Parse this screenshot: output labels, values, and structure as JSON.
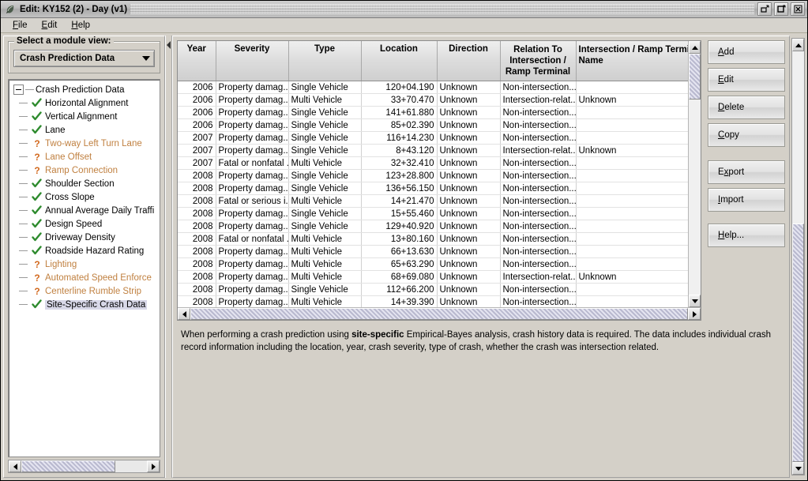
{
  "window": {
    "title": "Edit: KY152 (2) - Day (v1)",
    "icon": "app-leaf-icon",
    "controls": [
      {
        "name": "restore-button",
        "icon": "restore-icon"
      },
      {
        "name": "maximize-button",
        "icon": "maximize-icon"
      },
      {
        "name": "close-button",
        "icon": "close-icon"
      }
    ]
  },
  "menubar": {
    "items": [
      {
        "label": "File",
        "mnemonic": "F"
      },
      {
        "label": "Edit",
        "mnemonic": "E"
      },
      {
        "label": "Help",
        "mnemonic": "H"
      }
    ]
  },
  "sidebar": {
    "group_legend": "Select a module view:",
    "combo": {
      "selected": "Crash Prediction Data",
      "icon": "chevron-down-icon"
    },
    "tree": {
      "root": {
        "label": "Crash Prediction Data",
        "expanded": true
      },
      "items": [
        {
          "label": "Horizontal Alignment",
          "status": "complete",
          "icon": "check-icon"
        },
        {
          "label": "Vertical Alignment",
          "status": "complete",
          "icon": "check-icon"
        },
        {
          "label": "Lane",
          "status": "complete",
          "icon": "check-icon"
        },
        {
          "label": "Two-way Left Turn Lane",
          "status": "warning",
          "icon": "question-icon"
        },
        {
          "label": "Lane Offset",
          "status": "warning",
          "icon": "question-icon"
        },
        {
          "label": "Ramp Connection",
          "status": "warning",
          "icon": "question-icon"
        },
        {
          "label": "Shoulder Section",
          "status": "complete",
          "icon": "check-icon"
        },
        {
          "label": "Cross Slope",
          "status": "complete",
          "icon": "check-icon"
        },
        {
          "label": "Annual Average Daily Traffi",
          "status": "complete",
          "icon": "check-icon"
        },
        {
          "label": "Design Speed",
          "status": "complete",
          "icon": "check-icon"
        },
        {
          "label": "Driveway Density",
          "status": "complete",
          "icon": "check-icon"
        },
        {
          "label": "Roadside Hazard Rating",
          "status": "complete",
          "icon": "check-icon"
        },
        {
          "label": "Lighting",
          "status": "warning",
          "icon": "question-icon"
        },
        {
          "label": "Automated Speed Enforce",
          "status": "warning",
          "icon": "question-icon"
        },
        {
          "label": "Centerline Rumble Strip",
          "status": "warning",
          "icon": "question-icon"
        },
        {
          "label": "Site-Specific Crash Data",
          "status": "complete",
          "icon": "check-icon",
          "selected": true
        }
      ]
    },
    "scrollbar": {
      "left_icon": "scroll-left-icon",
      "right_icon": "scroll-right-icon"
    }
  },
  "splitter": {
    "icon": "collapse-left-icon"
  },
  "table": {
    "columns": [
      "Year",
      "Severity",
      "Type",
      "Location",
      "Direction",
      "Relation To Intersection / Ramp Terminal",
      "Intersection / Ramp Terminal Name"
    ],
    "rows": [
      {
        "year": "2006",
        "severity": "Property damag...",
        "type": "Single Vehicle",
        "location": "120+04.190",
        "direction": "Unknown",
        "relation": "Non-intersection...",
        "name": ""
      },
      {
        "year": "2006",
        "severity": "Property damag...",
        "type": "Multi Vehicle",
        "location": "33+70.470",
        "direction": "Unknown",
        "relation": "Intersection-relat...",
        "name": "Unknown"
      },
      {
        "year": "2006",
        "severity": "Property damag...",
        "type": "Single Vehicle",
        "location": "141+61.880",
        "direction": "Unknown",
        "relation": "Non-intersection...",
        "name": ""
      },
      {
        "year": "2006",
        "severity": "Property damag...",
        "type": "Single Vehicle",
        "location": "85+02.390",
        "direction": "Unknown",
        "relation": "Non-intersection...",
        "name": ""
      },
      {
        "year": "2007",
        "severity": "Property damag...",
        "type": "Single Vehicle",
        "location": "116+14.230",
        "direction": "Unknown",
        "relation": "Non-intersection...",
        "name": ""
      },
      {
        "year": "2007",
        "severity": "Property damag...",
        "type": "Single Vehicle",
        "location": "8+43.120",
        "direction": "Unknown",
        "relation": "Intersection-relat...",
        "name": "Unknown"
      },
      {
        "year": "2007",
        "severity": "Fatal or nonfatal ...",
        "type": "Multi Vehicle",
        "location": "32+32.410",
        "direction": "Unknown",
        "relation": "Non-intersection...",
        "name": ""
      },
      {
        "year": "2008",
        "severity": "Property damag...",
        "type": "Single Vehicle",
        "location": "123+28.800",
        "direction": "Unknown",
        "relation": "Non-intersection...",
        "name": ""
      },
      {
        "year": "2008",
        "severity": "Property damag...",
        "type": "Single Vehicle",
        "location": "136+56.150",
        "direction": "Unknown",
        "relation": "Non-intersection...",
        "name": ""
      },
      {
        "year": "2008",
        "severity": "Fatal or serious i...",
        "type": "Multi Vehicle",
        "location": "14+21.470",
        "direction": "Unknown",
        "relation": "Non-intersection...",
        "name": ""
      },
      {
        "year": "2008",
        "severity": "Property damag...",
        "type": "Single Vehicle",
        "location": "15+55.460",
        "direction": "Unknown",
        "relation": "Non-intersection...",
        "name": ""
      },
      {
        "year": "2008",
        "severity": "Property damag...",
        "type": "Single Vehicle",
        "location": "129+40.920",
        "direction": "Unknown",
        "relation": "Non-intersection...",
        "name": ""
      },
      {
        "year": "2008",
        "severity": "Fatal or nonfatal ...",
        "type": "Multi Vehicle",
        "location": "13+80.160",
        "direction": "Unknown",
        "relation": "Non-intersection...",
        "name": ""
      },
      {
        "year": "2008",
        "severity": "Property damag...",
        "type": "Multi Vehicle",
        "location": "66+13.630",
        "direction": "Unknown",
        "relation": "Non-intersection...",
        "name": ""
      },
      {
        "year": "2008",
        "severity": "Property damag...",
        "type": "Multi Vehicle",
        "location": "65+63.290",
        "direction": "Unknown",
        "relation": "Non-intersection...",
        "name": ""
      },
      {
        "year": "2008",
        "severity": "Property damag...",
        "type": "Multi Vehicle",
        "location": "68+69.080",
        "direction": "Unknown",
        "relation": "Intersection-relat...",
        "name": "Unknown"
      },
      {
        "year": "2008",
        "severity": "Property damag...",
        "type": "Single Vehicle",
        "location": "112+66.200",
        "direction": "Unknown",
        "relation": "Non-intersection...",
        "name": ""
      },
      {
        "year": "2008",
        "severity": "Property damag...",
        "type": "Multi Vehicle",
        "location": "14+39.390",
        "direction": "Unknown",
        "relation": "Non-intersection...",
        "name": ""
      }
    ]
  },
  "actions": {
    "buttons": [
      {
        "label": "Add",
        "mnemonic": "A"
      },
      {
        "label": "Edit",
        "mnemonic": "E"
      },
      {
        "label": "Delete",
        "mnemonic": "D"
      },
      {
        "label": "Copy",
        "mnemonic": "C"
      },
      {
        "label": "Export",
        "mnemonic": "x"
      },
      {
        "label": "Import",
        "mnemonic": "I"
      },
      {
        "label": "Help...",
        "mnemonic": "H"
      }
    ]
  },
  "description": {
    "part1": "When performing a crash prediction using ",
    "emphasis": "site-specific",
    "part2": " Empirical-Bayes analysis, crash history data is required. The data includes individual crash record information including the location, year, crash severity, type of crash, whether the crash was intersection related."
  },
  "colors": {
    "warning_text": "#c08040",
    "check_green": "#2e8b2e",
    "window_bg": "#d4d0c8",
    "selection": "#d8d8e8"
  }
}
